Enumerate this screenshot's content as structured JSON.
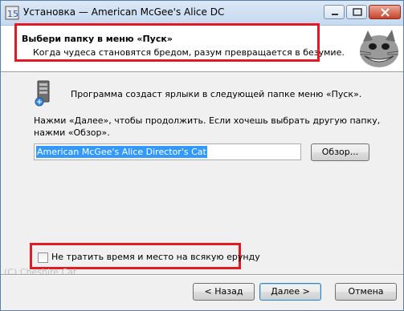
{
  "window": {
    "title": "Установка — American McGee's Alice DC",
    "controls": [
      "minimize-icon",
      "maximize-icon",
      "close-icon"
    ]
  },
  "header": {
    "title": "Выбери папку в меню «Пуск»",
    "subtitle": "Когда чудеса становятся бредом, разум превращается в безумие.",
    "image": "cheshire-cat-image"
  },
  "body": {
    "intro": "Программа создаст ярлыки в следующей папке меню «Пуск».",
    "instructions": "Нажми «Далее», чтобы продолжить. Если хочешь выбрать другую папку, нажми «Обзор».",
    "folder_value": "American McGee's Alice Director's Cat",
    "browse_label": "Обзор...",
    "checkbox_label": "Не тратить время и место на всякую ерунду",
    "checkbox_checked": false,
    "watermark": "(C) Cheshire Cat"
  },
  "footer": {
    "back_label": "< Назад",
    "next_label": "Далее >",
    "cancel_label": "Отмена"
  },
  "colors": {
    "highlight_box": "#e01b24",
    "selection": "#3399ff"
  }
}
